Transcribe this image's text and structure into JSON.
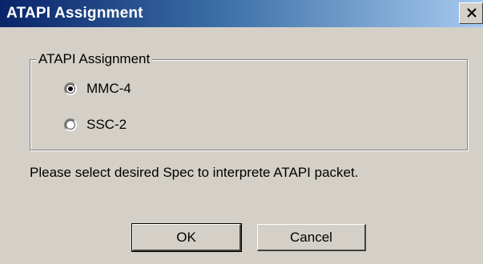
{
  "window": {
    "title": "ATAPI Assignment",
    "close_icon": "close-icon"
  },
  "group": {
    "legend": "ATAPI Assignment",
    "options": [
      {
        "label": "MMC-4",
        "selected": true
      },
      {
        "label": "SSC-2",
        "selected": false
      }
    ]
  },
  "message": "Please select desired Spec to interprete ATAPI packet.",
  "buttons": {
    "ok_label": "OK",
    "cancel_label": "Cancel"
  }
}
